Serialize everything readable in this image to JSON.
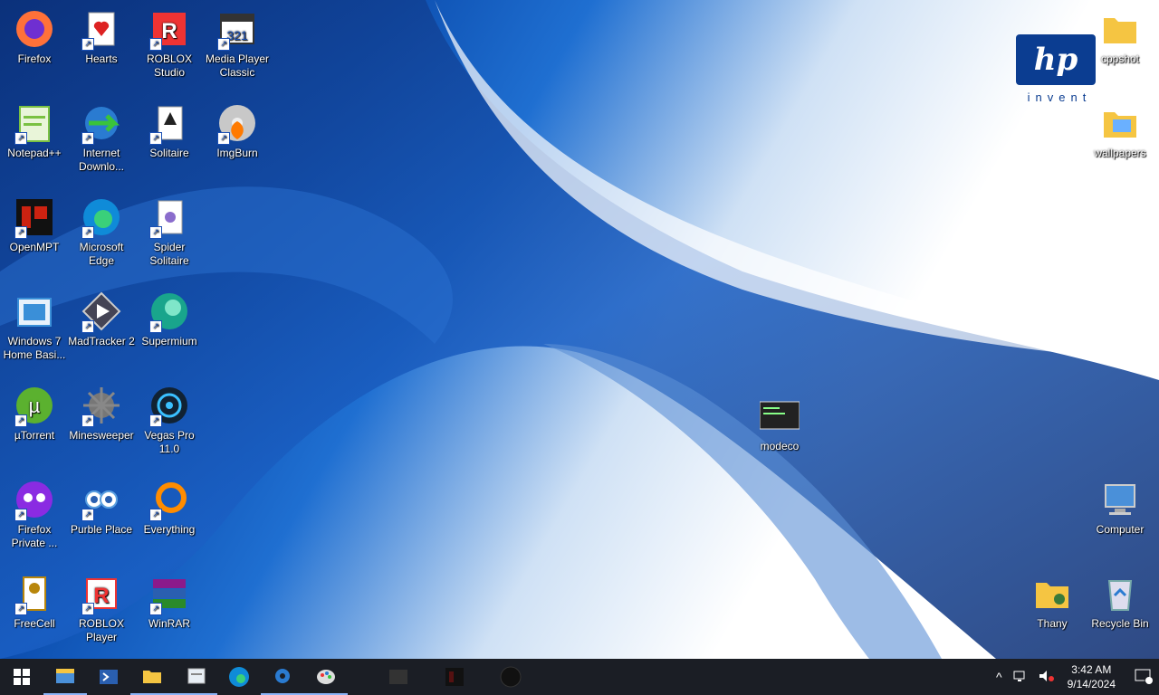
{
  "desktop": {
    "icons": [
      {
        "label": "Firefox",
        "icon": "firefox-icon",
        "color": "#ff7139"
      },
      {
        "label": "Hearts",
        "icon": "hearts-icon",
        "color": "#d22"
      },
      {
        "label": "ROBLOX Studio",
        "icon": "roblox-studio-icon",
        "color": "#e33"
      },
      {
        "label": "Media Player Classic",
        "icon": "media-player-classic-icon",
        "color": "#333"
      },
      {
        "label": "Notepad++",
        "icon": "notepadpp-icon",
        "color": "#7ac142"
      },
      {
        "label": "Internet Downlo...",
        "icon": "idm-icon",
        "color": "#2a8a2a"
      },
      {
        "label": "Solitaire",
        "icon": "solitaire-icon",
        "color": "#ddd"
      },
      {
        "label": "ImgBurn",
        "icon": "imgburn-icon",
        "color": "#c8c8c8"
      },
      {
        "label": "OpenMPT",
        "icon": "openmpt-icon",
        "color": "#b00"
      },
      {
        "label": "Microsoft Edge",
        "icon": "edge-icon",
        "color": "#0f8bd8"
      },
      {
        "label": "Spider Solitaire",
        "icon": "spider-solitaire-icon",
        "color": "#8a6ccc"
      },
      {
        "label": "Windows 7 Home Basi...",
        "icon": "windows7-icon",
        "color": "#3a8fd8"
      },
      {
        "label": "MadTracker 2",
        "icon": "madtracker-icon",
        "color": "#445"
      },
      {
        "label": "Supermium",
        "icon": "supermium-icon",
        "color": "#19a58c"
      },
      {
        "label": "µTorrent",
        "icon": "utorrent-icon",
        "color": "#5bb12f"
      },
      {
        "label": "Minesweeper",
        "icon": "minesweeper-icon",
        "color": "#999"
      },
      {
        "label": "Vegas Pro 11.0",
        "icon": "vegas-pro-icon",
        "color": "#123"
      },
      {
        "label": "Firefox Private ...",
        "icon": "firefox-private-icon",
        "color": "#8a2be2"
      },
      {
        "label": "Purble Place",
        "icon": "purble-place-icon",
        "color": "#5a9fe0"
      },
      {
        "label": "Everything",
        "icon": "everything-icon",
        "color": "#ff8c00"
      },
      {
        "label": "FreeCell",
        "icon": "freecell-icon",
        "color": "#b8860b"
      },
      {
        "label": "ROBLOX Player",
        "icon": "roblox-player-icon",
        "color": "#e33"
      },
      {
        "label": "WinRAR",
        "icon": "winrar-icon",
        "color": "#8b1a8b"
      },
      {
        "label": "cppshot",
        "icon": "folder-icon",
        "color": "#f5c542"
      },
      {
        "label": "wallpapers",
        "icon": "folder-icon",
        "color": "#f5c542"
      },
      {
        "label": "modeco",
        "icon": "screenshot-file-icon",
        "color": "#222"
      },
      {
        "label": "Computer",
        "icon": "computer-icon",
        "color": "#4a90d9"
      },
      {
        "label": "Thany",
        "icon": "user-folder-icon",
        "color": "#f5c542"
      },
      {
        "label": "Recycle Bin",
        "icon": "recycle-bin-icon",
        "color": "#7aa"
      }
    ],
    "hp_logo": {
      "text": "hp",
      "tagline": "invent"
    }
  },
  "taskbar": {
    "start_icon": "windows-start-icon",
    "pinned": [
      {
        "icon": "file-explorer-icon",
        "active": true
      },
      {
        "icon": "powershell-icon",
        "active": false
      },
      {
        "icon": "folder-icon",
        "active": true
      },
      {
        "icon": "notepad-icon",
        "active": true
      },
      {
        "icon": "edge-icon",
        "active": false
      },
      {
        "icon": "settings-icon",
        "active": true
      },
      {
        "icon": "paint-icon",
        "active": true
      },
      {
        "icon": "media-player-classic-icon",
        "active": false
      },
      {
        "icon": "openmpt-icon",
        "active": false
      },
      {
        "icon": "app-icon",
        "active": false
      }
    ],
    "tray": {
      "time": "3:42 AM",
      "date": "9/14/2024",
      "notification_count": "1"
    }
  }
}
